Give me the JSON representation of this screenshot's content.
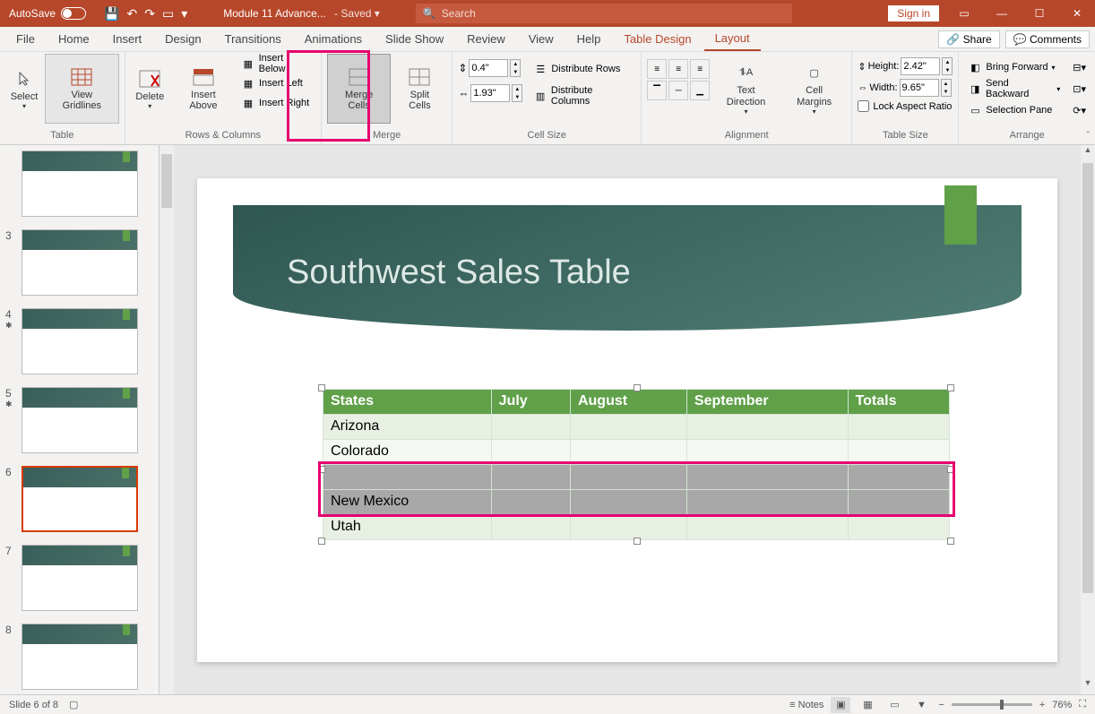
{
  "titlebar": {
    "autosave_label": "AutoSave",
    "autosave_state": "On",
    "doc_title": "Module 11 Advance...",
    "saved_state": "- Saved ▾",
    "search_placeholder": "Search",
    "signin": "Sign in"
  },
  "tabs": {
    "items": [
      "File",
      "Home",
      "Insert",
      "Design",
      "Transitions",
      "Animations",
      "Slide Show",
      "Review",
      "View",
      "Help",
      "Table Design",
      "Layout"
    ],
    "active": "Layout",
    "share": "Share",
    "comments": "Comments"
  },
  "ribbon": {
    "table": {
      "select": "Select",
      "view_gridlines": "View Gridlines",
      "group": "Table"
    },
    "rows_cols": {
      "delete": "Delete",
      "insert_above": "Insert Above",
      "insert_below": "Insert Below",
      "insert_left": "Insert Left",
      "insert_right": "Insert Right",
      "group": "Rows & Columns"
    },
    "merge": {
      "merge_cells": "Merge Cells",
      "split_cells": "Split Cells",
      "group": "Merge"
    },
    "cell_size": {
      "height_val": "0.4\"",
      "width_val": "1.93\"",
      "dist_rows": "Distribute Rows",
      "dist_cols": "Distribute Columns",
      "group": "Cell Size"
    },
    "alignment": {
      "text_dir": "Text Direction",
      "cell_margins": "Cell Margins",
      "group": "Alignment"
    },
    "table_size": {
      "height_label": "Height:",
      "height_val": "2.42\"",
      "width_label": "Width:",
      "width_val": "9.65\"",
      "lock": "Lock Aspect Ratio",
      "group": "Table Size"
    },
    "arrange": {
      "bring_fwd": "Bring Forward",
      "send_back": "Send Backward",
      "sel_pane": "Selection Pane",
      "group": "Arrange"
    }
  },
  "slide": {
    "title": "Southwest Sales Table",
    "table": {
      "headers": [
        "States",
        "July",
        "August",
        "September",
        "Totals"
      ],
      "rows": [
        {
          "state": "Arizona",
          "cls": "a"
        },
        {
          "state": "Colorado",
          "cls": "b"
        },
        {
          "state": "",
          "cls": "sel"
        },
        {
          "state": "New Mexico",
          "cls": "sel"
        },
        {
          "state": "Utah",
          "cls": "a"
        }
      ]
    }
  },
  "thumbs": {
    "items": [
      {
        "num": "",
        "star": ""
      },
      {
        "num": "3",
        "star": ""
      },
      {
        "num": "4",
        "star": "*"
      },
      {
        "num": "5",
        "star": "*"
      },
      {
        "num": "6",
        "star": "",
        "selected": true
      },
      {
        "num": "7",
        "star": ""
      },
      {
        "num": "8",
        "star": ""
      }
    ]
  },
  "status": {
    "slide_info": "Slide 6 of 8",
    "notes": "Notes",
    "zoom": "76%"
  }
}
